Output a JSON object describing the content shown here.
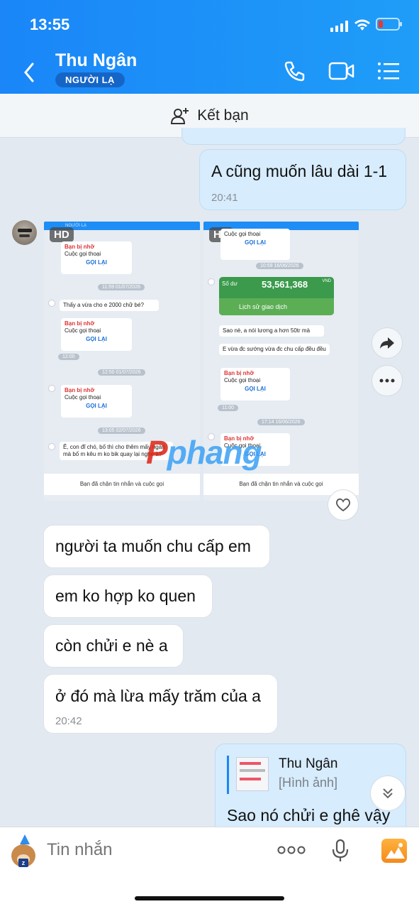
{
  "status": {
    "time": "13:55"
  },
  "header": {
    "name": "Thu Ngân",
    "badge": "NGƯỜI LẠ"
  },
  "add_friend": {
    "label": "Kết bạn"
  },
  "messages": {
    "out1": {
      "text": "A cũng muốn lâu dài 1-1",
      "time": "20:41"
    },
    "in1": {
      "text": "người ta muốn chu cấp em"
    },
    "in2": {
      "text": "em ko hợp ko quen"
    },
    "in3": {
      "text": "còn chửi e nè a"
    },
    "in4": {
      "text": "ở đó mà lừa mấy trăm của a",
      "time": "20:42"
    },
    "out2": {
      "reply_name": "Thu Ngân",
      "reply_type": "[Hình ảnh]",
      "text": "Sao nó chửi e ghê vậy"
    }
  },
  "shot1": {
    "hd": "HD",
    "header": "NGƯỜI LẠ",
    "missed": "Bạn bị nhỡ",
    "call": "Cuộc gọi thoại",
    "callback": "GỌI LẠI",
    "d1": "11:59 01/07/2026",
    "m1": "Thấy a vừa cho e 2000 chữ bé?",
    "t1": "12:00",
    "d2": "12:50 01/07/2026",
    "d3": "13:05 02/07/2026",
    "m2": "Ê, con đĩ chó, bố thì cho thêm mấy ngàn mà bố m kêu m ko bik quay lại nghe à?",
    "blocked": "Bạn đã chặn tin nhắn và cuộc gọi"
  },
  "shot2": {
    "hd": "HD",
    "missed": "Bạn bị nhỡ",
    "call": "Cuộc gọi thoại",
    "callback": "GỌI LẠI",
    "d1": "10:59 16/06/2026",
    "balance_label": "Số dư",
    "balance": "53,561,368",
    "currency": "VND",
    "history": "Lịch sử giao dịch",
    "m1": "Sao nè, a nói lương a hơn 50tr mà",
    "m2": "E vừa đc sướng vừa đc chu cấp đều đều",
    "t1": "11:00",
    "d2": "17:14 16/06/2026",
    "blocked": "Bạn đã chặn tin nhắn và cuộc gọi"
  },
  "watermark": "phang",
  "input": {
    "placeholder": "Tin nhắn"
  },
  "colors": {
    "header": "#1a86f8",
    "out_bubble": "#d7ecfd",
    "in_bubble": "#ffffff",
    "background": "#e2e9f1"
  }
}
